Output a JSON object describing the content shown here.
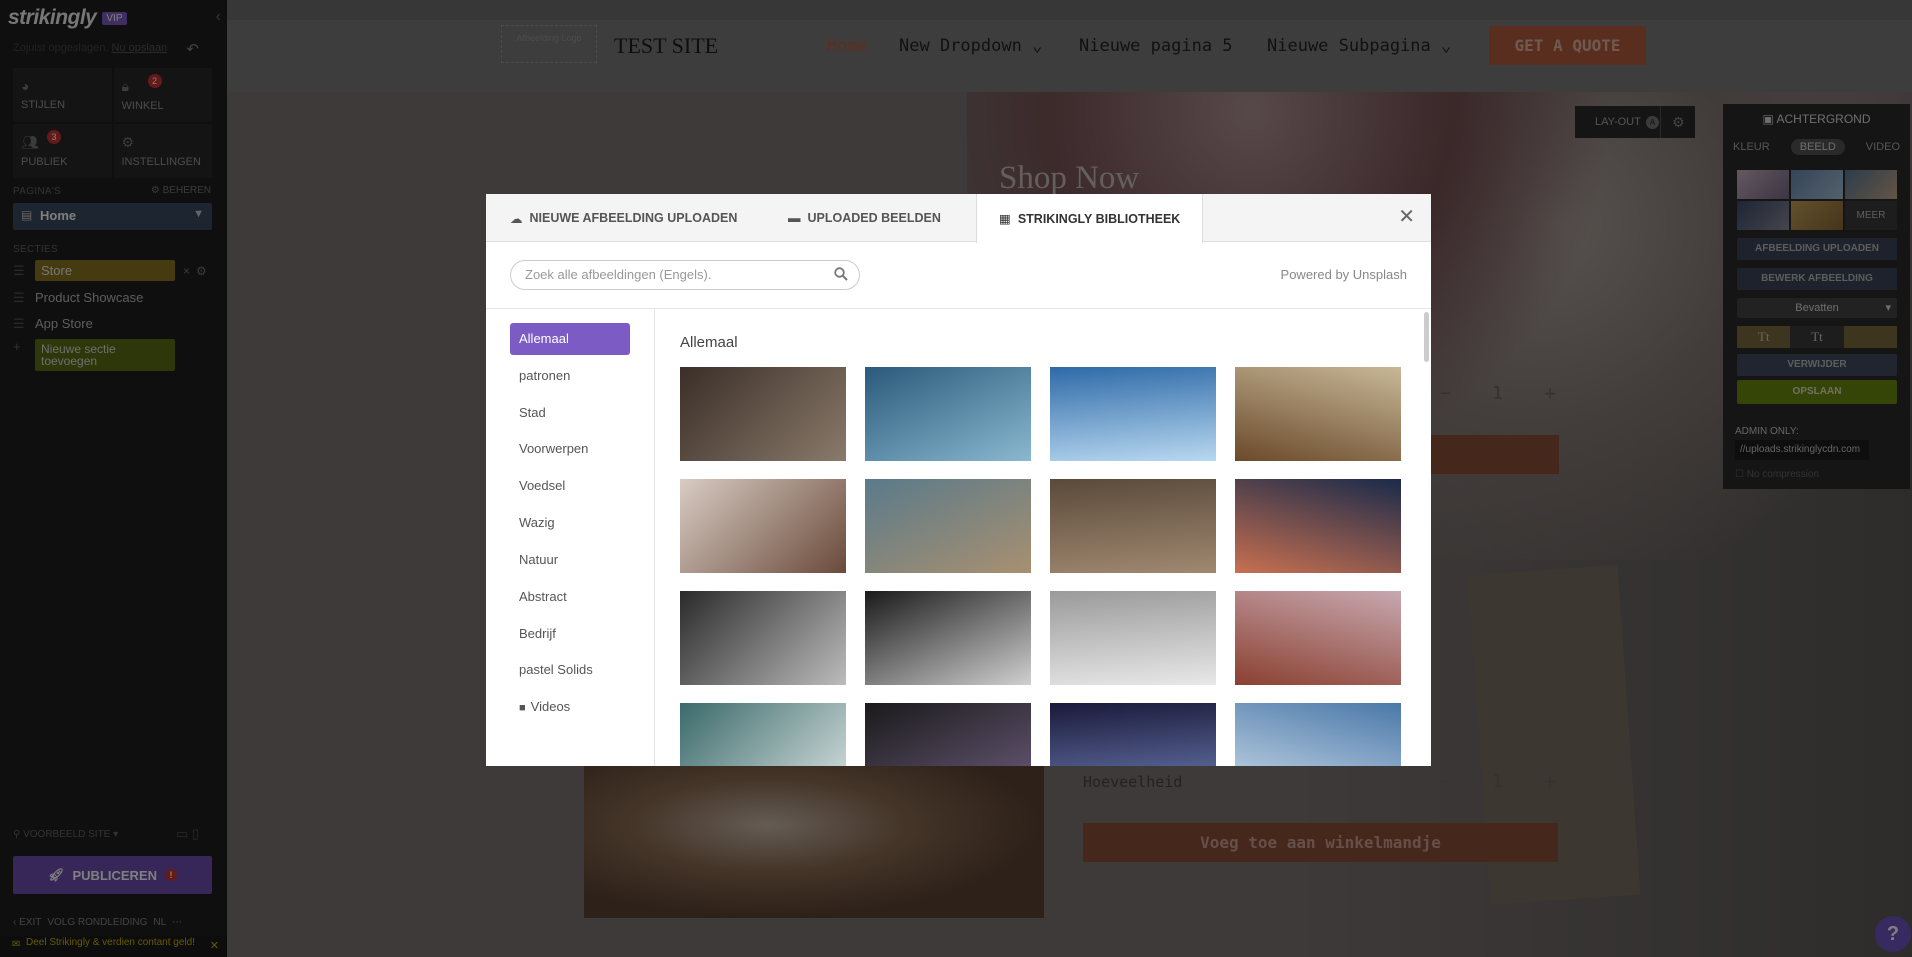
{
  "sidebar": {
    "logo": "strikingly",
    "vip": "VIP",
    "saved_text": "Zojuist opgeslagen.",
    "saved_link": "Nu opslaan",
    "tiles": [
      {
        "label": "STIJLEN",
        "icon": "palette-icon",
        "badge": ""
      },
      {
        "label": "WINKEL",
        "icon": "lock-icon",
        "badge": "2"
      },
      {
        "label": "PUBLIEK",
        "icon": "users-icon",
        "badge": "3"
      },
      {
        "label": "INSTELLINGEN",
        "icon": "gear-icon",
        "badge": ""
      }
    ],
    "pages_label": "PAGINA'S",
    "manage_label": "BEHEREN",
    "current_page": "Home",
    "sections_label": "SECTIES",
    "sections": [
      "Store",
      "Product Showcase",
      "App Store"
    ],
    "new_section": "Nieuwe sectie toevoegen",
    "preview_label": "VOORBEELD SITE",
    "publish_label": "PUBLICEREN",
    "footer_links": [
      "EXIT",
      "VOLG RONDLEIDING",
      "NL"
    ],
    "share_text": "Deel Strikingly & verdien contant geld!"
  },
  "site": {
    "logo_placeholder": "Afbeelding Logo",
    "title": "TEST SITE",
    "nav": [
      {
        "label": "Home",
        "color": "#c05a38"
      },
      {
        "label": "New Dropdown",
        "color": "#222222"
      },
      {
        "label": "Nieuwe pagina 5",
        "color": "#222222"
      },
      {
        "label": "Nieuwe Subpagina",
        "color": "#222222"
      }
    ],
    "cta": "GET A QUOTE",
    "hero_heading": "Shop Now",
    "layout_label": "LAY-OUT",
    "layout_badge": "A",
    "quantity_label": "Hoeveelheid",
    "quantity_value": "1",
    "add_to_cart": "Voeg toe aan winkelmandje",
    "add_to_cart_partial": "je",
    "help": "?"
  },
  "background_panel": {
    "title": "ACHTERGROND",
    "tabs": [
      "KLEUR",
      "BEELD",
      "VIDEO"
    ],
    "active_tab": "BEELD",
    "more": "MEER",
    "upload": "AFBEELDING UPLOADEN",
    "edit": "BEWERK AFBEELDING",
    "fit": "Bevatten",
    "text_style": "Tt",
    "delete": "VERWIJDER",
    "save": "OPSLAAN",
    "admin_only": "ADMIN ONLY:",
    "url": "//uploads.strikinglycdn.com",
    "no_compression": "No compression"
  },
  "modal": {
    "tabs": [
      {
        "label": "NIEUWE AFBEELDING UPLOADEN",
        "icon": "cloud-upload-icon"
      },
      {
        "label": "UPLOADED BEELDEN",
        "icon": "folder-icon"
      },
      {
        "label": "STRIKINGLY BIBLIOTHEEK",
        "icon": "library-icon"
      }
    ],
    "active_tab": "STRIKINGLY BIBLIOTHEEK",
    "search_placeholder": "Zoek alle afbeeldingen (Engels).",
    "powered_by": "Powered by Unsplash",
    "categories": [
      "Allemaal",
      "patronen",
      "Stad",
      "Voorwerpen",
      "Voedsel",
      "Wazig",
      "Natuur",
      "Abstract",
      "Bedrijf",
      "pastel Solids",
      "Videos"
    ],
    "active_category": "Allemaal",
    "heading": "Allemaal",
    "thumbnails": [
      {
        "name": "city-street-buildings",
        "colors": [
          "#3a2e28",
          "#8a7a6a"
        ]
      },
      {
        "name": "blue-skyscrapers",
        "colors": [
          "#2a5a7a",
          "#8ab8d0"
        ]
      },
      {
        "name": "ferris-wheel-sky",
        "colors": [
          "#2e6aa8",
          "#b8d8f0"
        ]
      },
      {
        "name": "golden-gate-bridge",
        "colors": [
          "#c8b898",
          "#6a4a2a"
        ]
      },
      {
        "name": "bicycle-alley",
        "colors": [
          "#d8ccc4",
          "#6a4a3a"
        ]
      },
      {
        "name": "steel-bridge-arches",
        "colors": [
          "#5a7a8a",
          "#a89070"
        ]
      },
      {
        "name": "hazy-city-skyline",
        "colors": [
          "#5a4a3a",
          "#a08870"
        ]
      },
      {
        "name": "light-trails-highway",
        "colors": [
          "#1a2a4a",
          "#c87050"
        ]
      },
      {
        "name": "subway-platform-bw",
        "colors": [
          "#2a2a2a",
          "#bcbcbc"
        ]
      },
      {
        "name": "tower-looking-up-bw",
        "colors": [
          "#1a1a1a",
          "#d0d0d0"
        ]
      },
      {
        "name": "foggy-skyline-bw",
        "colors": [
          "#9a9a9a",
          "#e8e8e8"
        ]
      },
      {
        "name": "colorful-mural-building",
        "colors": [
          "#c8a8b0",
          "#8a4030"
        ]
      },
      {
        "name": "glass-gherkin-tower",
        "colors": [
          "#3a6a6a",
          "#d8e0e0"
        ]
      },
      {
        "name": "dark-tower-corner",
        "colors": [
          "#1a1a1a",
          "#6a5a7a"
        ]
      },
      {
        "name": "blue-glass-facade",
        "colors": [
          "#1a1a3a",
          "#6a7ab0"
        ]
      },
      {
        "name": "waterfront-city",
        "colors": [
          "#4a78a8",
          "#c8d8e8"
        ]
      }
    ]
  }
}
